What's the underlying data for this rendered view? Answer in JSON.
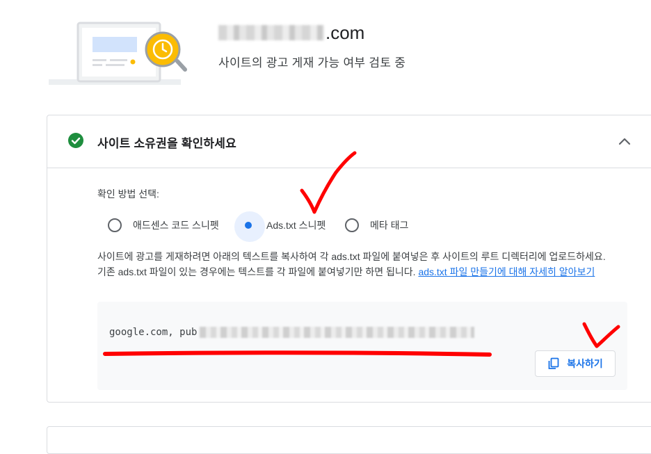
{
  "site": {
    "domain_suffix": ".com",
    "status": "사이트의 광고 게재 가능 여부 검토 중"
  },
  "card": {
    "title": "사이트 소유권을 확인하세요",
    "method_label": "확인 방법 선택:",
    "options": [
      {
        "label": "애드센스 코드 스니펫",
        "selected": false
      },
      {
        "label": "Ads.txt 스니펫",
        "selected": true
      },
      {
        "label": "메타 태그",
        "selected": false
      }
    ],
    "description": "사이트에 광고를 게재하려면 아래의 텍스트를 복사하여 각 ads.txt 파일에 붙여넣은 후 사이트의 루트 디렉터리에 업로드하세요. 기존 ads.txt 파일이 있는 경우에는 텍스트를 각 파일에 붙여넣기만 하면 됩니다. ",
    "learn_more_link": "ads.txt 파일 만들기에 대해 자세히 알아보기",
    "snippet_prefix": "google.com, pub",
    "copy_button": "복사하기"
  },
  "colors": {
    "accent": "#1a73e8",
    "success": "#1e8e3e",
    "annotation": "#ff0000"
  }
}
